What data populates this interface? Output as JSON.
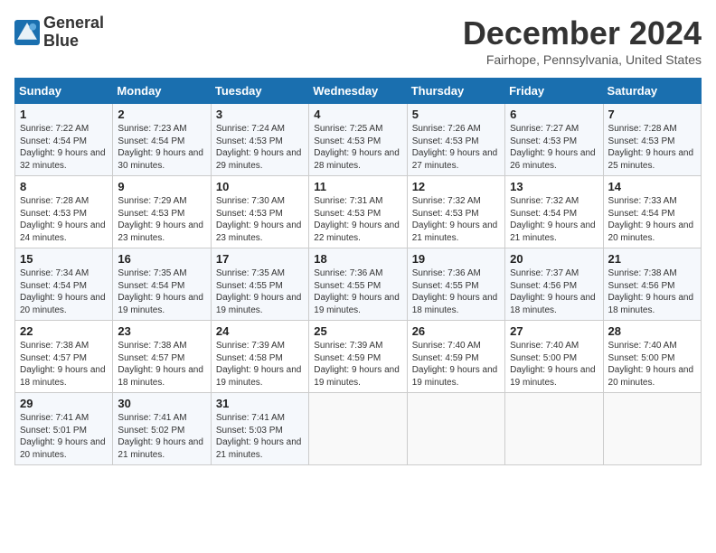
{
  "app": {
    "name_line1": "General",
    "name_line2": "Blue"
  },
  "header": {
    "month": "December 2024",
    "location": "Fairhope, Pennsylvania, United States"
  },
  "weekdays": [
    "Sunday",
    "Monday",
    "Tuesday",
    "Wednesday",
    "Thursday",
    "Friday",
    "Saturday"
  ],
  "weeks": [
    [
      {
        "day": "1",
        "sunrise": "7:22 AM",
        "sunset": "4:54 PM",
        "daylight": "9 hours and 32 minutes."
      },
      {
        "day": "2",
        "sunrise": "7:23 AM",
        "sunset": "4:54 PM",
        "daylight": "9 hours and 30 minutes."
      },
      {
        "day": "3",
        "sunrise": "7:24 AM",
        "sunset": "4:53 PM",
        "daylight": "9 hours and 29 minutes."
      },
      {
        "day": "4",
        "sunrise": "7:25 AM",
        "sunset": "4:53 PM",
        "daylight": "9 hours and 28 minutes."
      },
      {
        "day": "5",
        "sunrise": "7:26 AM",
        "sunset": "4:53 PM",
        "daylight": "9 hours and 27 minutes."
      },
      {
        "day": "6",
        "sunrise": "7:27 AM",
        "sunset": "4:53 PM",
        "daylight": "9 hours and 26 minutes."
      },
      {
        "day": "7",
        "sunrise": "7:28 AM",
        "sunset": "4:53 PM",
        "daylight": "9 hours and 25 minutes."
      }
    ],
    [
      {
        "day": "8",
        "sunrise": "7:28 AM",
        "sunset": "4:53 PM",
        "daylight": "9 hours and 24 minutes."
      },
      {
        "day": "9",
        "sunrise": "7:29 AM",
        "sunset": "4:53 PM",
        "daylight": "9 hours and 23 minutes."
      },
      {
        "day": "10",
        "sunrise": "7:30 AM",
        "sunset": "4:53 PM",
        "daylight": "9 hours and 23 minutes."
      },
      {
        "day": "11",
        "sunrise": "7:31 AM",
        "sunset": "4:53 PM",
        "daylight": "9 hours and 22 minutes."
      },
      {
        "day": "12",
        "sunrise": "7:32 AM",
        "sunset": "4:53 PM",
        "daylight": "9 hours and 21 minutes."
      },
      {
        "day": "13",
        "sunrise": "7:32 AM",
        "sunset": "4:54 PM",
        "daylight": "9 hours and 21 minutes."
      },
      {
        "day": "14",
        "sunrise": "7:33 AM",
        "sunset": "4:54 PM",
        "daylight": "9 hours and 20 minutes."
      }
    ],
    [
      {
        "day": "15",
        "sunrise": "7:34 AM",
        "sunset": "4:54 PM",
        "daylight": "9 hours and 20 minutes."
      },
      {
        "day": "16",
        "sunrise": "7:35 AM",
        "sunset": "4:54 PM",
        "daylight": "9 hours and 19 minutes."
      },
      {
        "day": "17",
        "sunrise": "7:35 AM",
        "sunset": "4:55 PM",
        "daylight": "9 hours and 19 minutes."
      },
      {
        "day": "18",
        "sunrise": "7:36 AM",
        "sunset": "4:55 PM",
        "daylight": "9 hours and 19 minutes."
      },
      {
        "day": "19",
        "sunrise": "7:36 AM",
        "sunset": "4:55 PM",
        "daylight": "9 hours and 18 minutes."
      },
      {
        "day": "20",
        "sunrise": "7:37 AM",
        "sunset": "4:56 PM",
        "daylight": "9 hours and 18 minutes."
      },
      {
        "day": "21",
        "sunrise": "7:38 AM",
        "sunset": "4:56 PM",
        "daylight": "9 hours and 18 minutes."
      }
    ],
    [
      {
        "day": "22",
        "sunrise": "7:38 AM",
        "sunset": "4:57 PM",
        "daylight": "9 hours and 18 minutes."
      },
      {
        "day": "23",
        "sunrise": "7:38 AM",
        "sunset": "4:57 PM",
        "daylight": "9 hours and 18 minutes."
      },
      {
        "day": "24",
        "sunrise": "7:39 AM",
        "sunset": "4:58 PM",
        "daylight": "9 hours and 19 minutes."
      },
      {
        "day": "25",
        "sunrise": "7:39 AM",
        "sunset": "4:59 PM",
        "daylight": "9 hours and 19 minutes."
      },
      {
        "day": "26",
        "sunrise": "7:40 AM",
        "sunset": "4:59 PM",
        "daylight": "9 hours and 19 minutes."
      },
      {
        "day": "27",
        "sunrise": "7:40 AM",
        "sunset": "5:00 PM",
        "daylight": "9 hours and 19 minutes."
      },
      {
        "day": "28",
        "sunrise": "7:40 AM",
        "sunset": "5:00 PM",
        "daylight": "9 hours and 20 minutes."
      }
    ],
    [
      {
        "day": "29",
        "sunrise": "7:41 AM",
        "sunset": "5:01 PM",
        "daylight": "9 hours and 20 minutes."
      },
      {
        "day": "30",
        "sunrise": "7:41 AM",
        "sunset": "5:02 PM",
        "daylight": "9 hours and 21 minutes."
      },
      {
        "day": "31",
        "sunrise": "7:41 AM",
        "sunset": "5:03 PM",
        "daylight": "9 hours and 21 minutes."
      },
      null,
      null,
      null,
      null
    ]
  ]
}
